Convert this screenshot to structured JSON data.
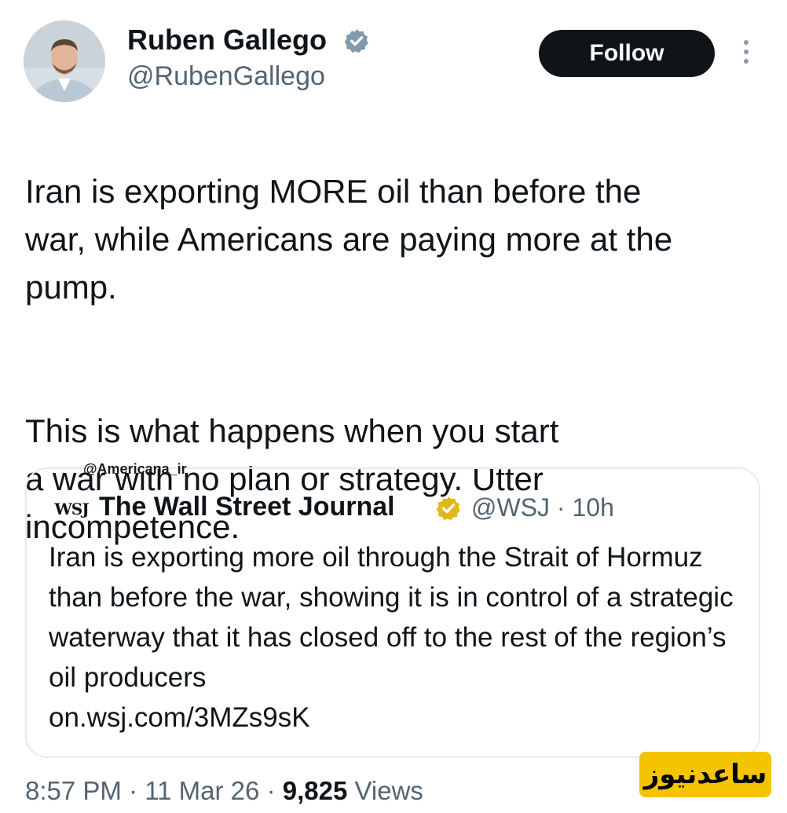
{
  "author": {
    "name": "Ruben Gallego",
    "handle": "@RubenGallego",
    "verified": true
  },
  "follow_button": {
    "label": "Follow"
  },
  "more_icon": "more-vertical-icon",
  "tweet": {
    "paragraphs": [
      "Iran is exporting MORE oil than before the\nwar, while Americans are paying more at the\npump.",
      "This is what happens when you start\na war with no plan or strategy. Utter\nincompetence."
    ]
  },
  "watermark_handle": "@Americana_ir",
  "quoted_tweet": {
    "logo_text": "WSJ",
    "name": "The Wall Street Journal",
    "verified": true,
    "handle": "@WSJ",
    "separator": "·",
    "time": "10h",
    "text": "Iran is exporting more oil through the Strait of Hormuz than before the war, showing it is in control of a strategic waterway that it has closed off to the rest of the region’s oil producers",
    "link": "on.wsj.com/3MZs9sK"
  },
  "footer": {
    "time": "8:57 PM",
    "date": "11 Mar 26",
    "separator": "·",
    "views_count": "9,825",
    "views_label": "Views"
  },
  "brand_watermark": {
    "text": "ساعدنیوز"
  },
  "colors": {
    "text_primary": "#0f1419",
    "text_secondary": "#536471",
    "verified_gray": "#829aab",
    "verified_gold": "#e2b719",
    "follow_bg": "#0f1419",
    "brand_bg": "#f5c400",
    "card_border": "#e6ecf0"
  }
}
